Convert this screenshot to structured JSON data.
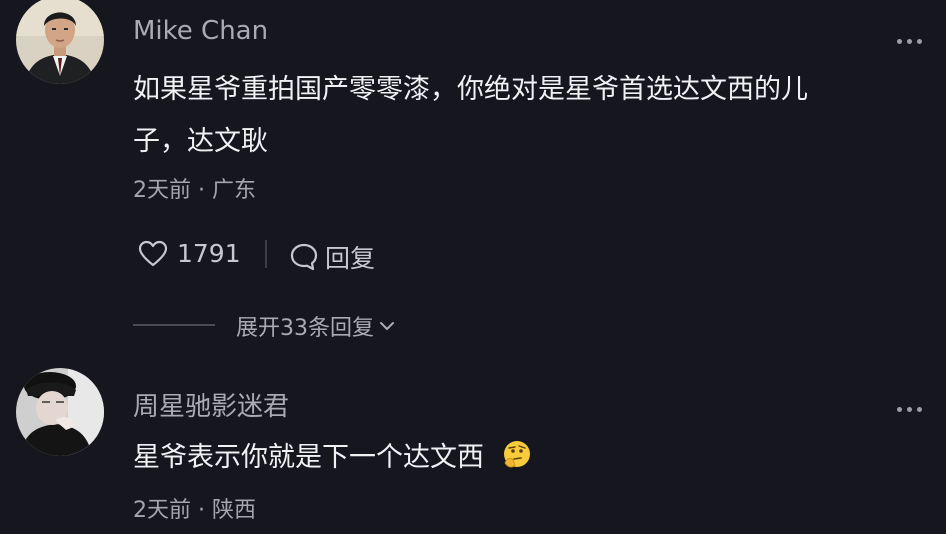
{
  "comments": [
    {
      "author": "Mike Chan",
      "content_line1": "如果星爷重拍国产零零漆，你绝对是星爷首选达文西的儿",
      "content_line2": "子，达文耿",
      "time": "2天前",
      "location": "广东",
      "likes": "1791",
      "reply_label": "回复",
      "avatar_icon": "avatar-man-in-suit-icon"
    },
    {
      "author": "周星驰影迷君",
      "content": "星爷表示你就是下一个达文西",
      "emoji_icon": "thinking-face-emoji-icon",
      "time": "2天前",
      "location": "陕西",
      "avatar_icon": "avatar-person-in-hat-icon"
    }
  ],
  "expand_replies": {
    "label": "展开33条回复"
  },
  "colors": {
    "background": "#15161e",
    "author": "#a9aab3",
    "content": "#f1f1f4",
    "meta": "#a4a5ae"
  }
}
